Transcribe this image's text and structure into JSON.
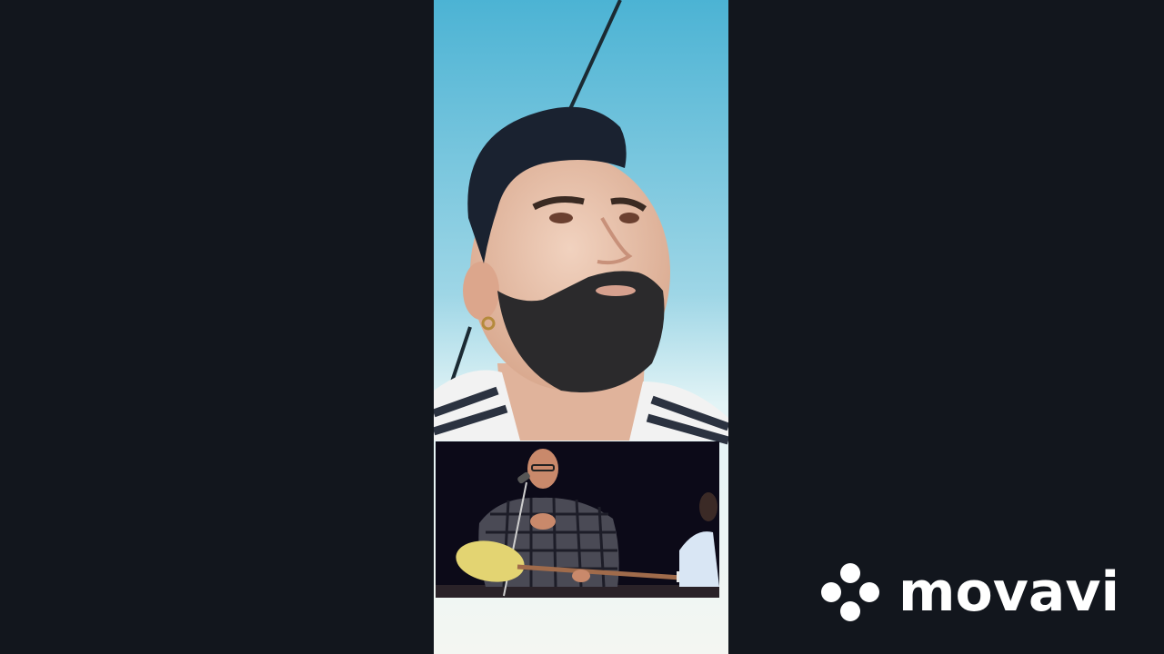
{
  "watermark": {
    "text": "movavi",
    "icon": "movavi-logo-icon",
    "color": "#ffffff"
  },
  "colors": {
    "background": "#12161d",
    "sky_top": "#4fb6d6",
    "sky_bottom": "#dff3f6"
  }
}
